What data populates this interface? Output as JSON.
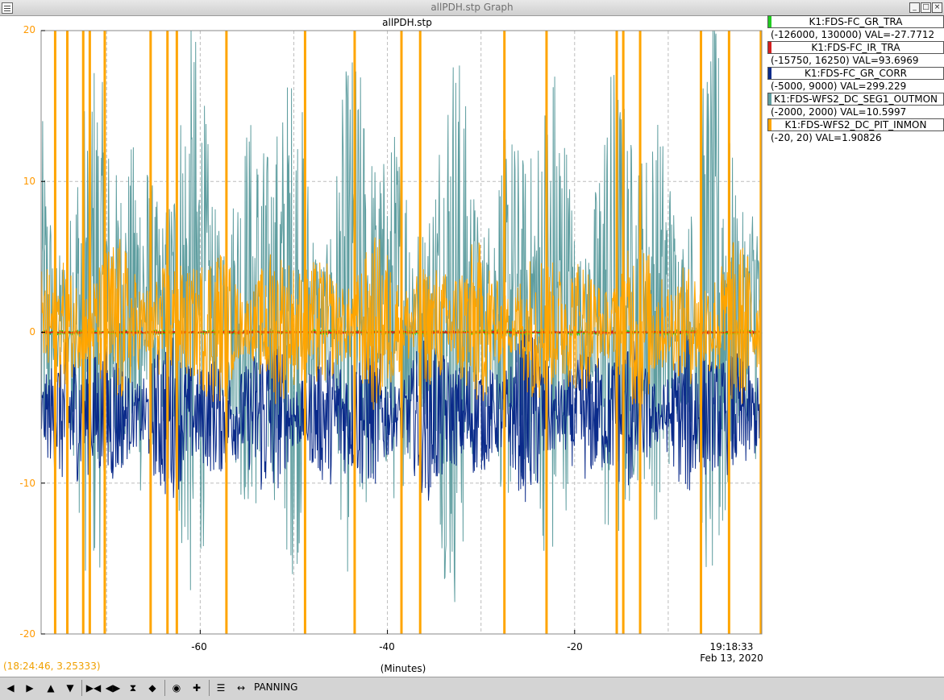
{
  "window": {
    "title": "allPDH.stp Graph"
  },
  "plot_title": "allPDH.stp",
  "legend": [
    {
      "name": "K1:FDS-FC_GR_TRA",
      "range_val": "(-126000, 130000) VAL=-27.7712",
      "color": "#22cc22"
    },
    {
      "name": "K1:FDS-FC_IR_TRA",
      "range_val": "(-15750, 16250) VAL=93.6969",
      "color": "#d42020"
    },
    {
      "name": "K1:FDS-FC_GR_CORR",
      "range_val": "(-5000, 9000) VAL=299.229",
      "color": "#0a2a8a"
    },
    {
      "name": "K1:FDS-WFS2_DC_SEG1_OUTMON",
      "range_val": "(-2000, 2000) VAL=10.5997",
      "color": "#5f9ea0"
    },
    {
      "name": "K1:FDS-WFS2_DC_PIT_INMON",
      "range_val": "(-20, 20) VAL=1.90826",
      "color": "#ffa500"
    }
  ],
  "axis": {
    "y_ticks": [
      "20",
      "10",
      "0",
      "-10",
      "-20"
    ],
    "x_ticks": [
      "-60",
      "-40",
      "-20"
    ],
    "time_label": "19:18:33",
    "date_label": "Feb 13, 2020",
    "x_title": "(Minutes)"
  },
  "cursor_readout": "(18:24:46, 3.25333)",
  "toolbar": {
    "mode_label": "PANNING"
  },
  "chart_data": {
    "type": "line",
    "title": "allPDH.stp",
    "xlabel": "(Minutes)",
    "xlim": [
      -77,
      0
    ],
    "ylim": [
      -20,
      20
    ],
    "grid": true,
    "y_tick_labels": [
      "20",
      "10",
      "0",
      "-10",
      "-20"
    ],
    "x_tick_labels": [
      "-60",
      "-40",
      "-20"
    ],
    "series": [
      {
        "name": "K1:FDS-FC_GR_TRA",
        "color": "#22cc22",
        "level": 0.0,
        "amp_min": 0.05,
        "amp_max": 0.15
      },
      {
        "name": "K1:FDS-FC_IR_TRA",
        "color": "#d42020",
        "level": 0.0,
        "amp_min": 0.02,
        "amp_max": 0.08
      },
      {
        "name": "K1:FDS-FC_GR_CORR",
        "color": "#0a2a8a",
        "level": -5.5,
        "amp_min": 2,
        "amp_max": 6
      },
      {
        "name": "K1:FDS-WFS2_DC_SEG1_OUTMON",
        "color": "#5f9ea0",
        "level": 1.0,
        "amp_min": 4,
        "amp_max": 20
      },
      {
        "name": "K1:FDS-WFS2_DC_PIT_INMON",
        "color": "#ffa500",
        "level": 0.5,
        "amp_min": 2,
        "amp_max": 6
      }
    ],
    "orange_spikes_min": [
      -75.5,
      -74.2,
      -72.5,
      -71.8,
      -70.2,
      -65.3,
      -63.5,
      -62.5,
      -57.2,
      -48.8,
      -43.5,
      -38.5,
      -36.5,
      -27.5,
      -23,
      -15.5,
      -14.8,
      -13,
      -6.5,
      -3.5,
      -0.1
    ]
  }
}
